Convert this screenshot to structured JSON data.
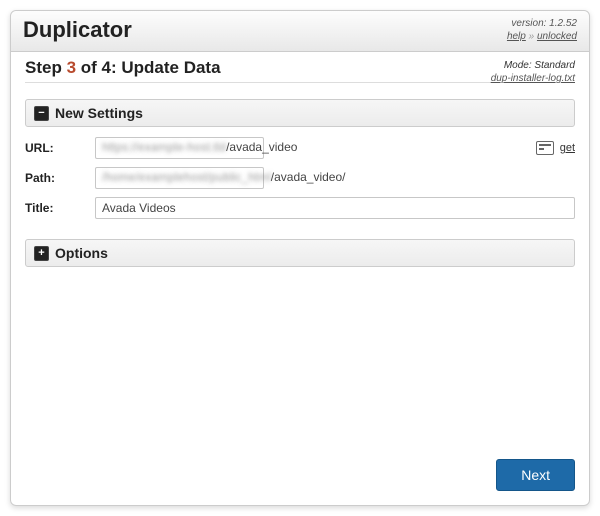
{
  "header": {
    "app_title": "Duplicator",
    "version_label": "version: 1.2.52",
    "help_label": "help",
    "separator": "»",
    "unlocked_label": "unlocked"
  },
  "subheader": {
    "mode_label": "Mode: Standard",
    "log_link": "dup-installer-log.txt",
    "step_prefix": "Step ",
    "step_number": "3",
    "step_suffix": " of 4: Update Data"
  },
  "panels": {
    "new_settings_title": "New Settings",
    "options_title": "Options"
  },
  "form": {
    "url": {
      "label": "URL:",
      "value_visible": "/avada_video",
      "get_label": "get"
    },
    "path": {
      "label": "Path:",
      "value_visible": "/avada_video/"
    },
    "title": {
      "label": "Title:",
      "value": "Avada Videos"
    }
  },
  "footer": {
    "next_label": "Next"
  }
}
